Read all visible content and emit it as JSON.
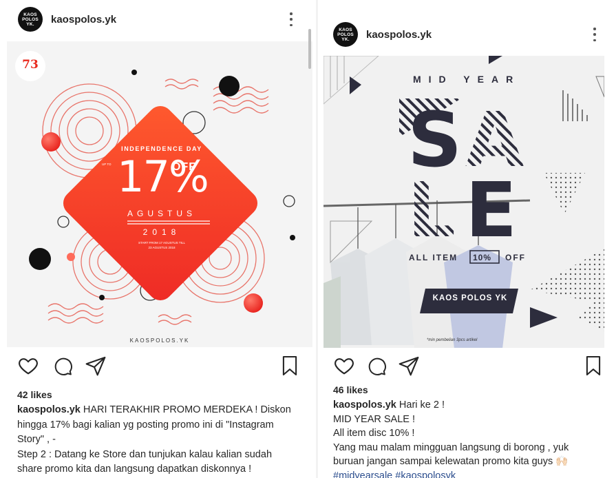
{
  "posts": [
    {
      "username": "kaospolos.yk",
      "avatar_text": [
        "KAOS",
        "POLOS",
        "YK."
      ],
      "image": {
        "badge": "73",
        "event": "INDEPENDENCE DAY",
        "up_to": "UP TO",
        "discount": "17%",
        "off": "OFF",
        "month": "AGUSTUS",
        "year": "2018",
        "fine_print_1": "START FROM 17 AGUSTUS TILL",
        "fine_print_2": "23 AGUSTUS 2018",
        "brand": "KAOSPOLOS.YK",
        "accent": "#ff3b22"
      },
      "likes": "42 likes",
      "caption_user": "kaospolos.yk",
      "caption_lines": [
        "HARI TERAKHIR PROMO MERDEKA ! Diskon",
        "hingga 17% bagi kalian yg posting promo ini di \"Instagram",
        "Story\" , -",
        "Step 2 : Datang ke Store dan tunjukan kalau kalian sudah",
        "share promo kita dan langsung dapatkan diskonnya !"
      ]
    },
    {
      "username": "kaospolos.yk",
      "avatar_text": [
        "KAOS",
        "POLOS",
        "YK."
      ],
      "image": {
        "headline": "MID YEAR",
        "sale_1": "SA",
        "sale_2": "LE",
        "all_item": "ALL ITEM",
        "percent": "10%",
        "off": "OFF",
        "button": "KAOS POLOS YK",
        "fine_print": "*min pembelian 3pcs artikel",
        "ink": "#2d2d3d"
      },
      "likes": "46 likes",
      "caption_user": "kaospolos.yk",
      "caption_first": "Hari ke 2 !",
      "caption_lines": [
        "MID YEAR SALE !",
        "All item disc 10% !",
        "Yang mau malam mingguan langsung di borong , yuk",
        "buruan jangan sampai kelewatan promo kita guys 🙌🏻"
      ],
      "hashtags": "#midyearsale #kaospolosyk"
    }
  ],
  "icons": [
    "heart-icon",
    "comment-icon",
    "share-icon",
    "bookmark-icon",
    "more-options-icon"
  ]
}
